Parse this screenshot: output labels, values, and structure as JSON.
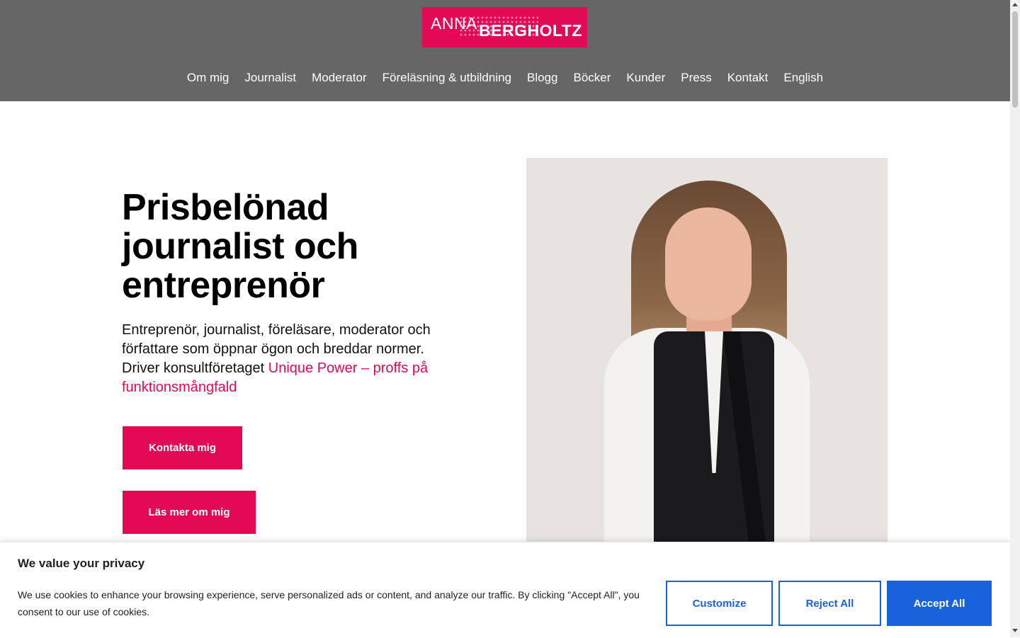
{
  "brand": {
    "first_name": "ANNA",
    "last_name": "BERGHOLTZ",
    "accent_color": "#e20a54",
    "header_color": "#666666"
  },
  "nav": {
    "items": [
      {
        "label": "Om mig"
      },
      {
        "label": "Journalist"
      },
      {
        "label": "Moderator"
      },
      {
        "label": "Föreläsning & utbildning"
      },
      {
        "label": "Blogg"
      },
      {
        "label": "Böcker"
      },
      {
        "label": "Kunder"
      },
      {
        "label": "Press"
      },
      {
        "label": "Kontakt"
      },
      {
        "label": "English"
      }
    ]
  },
  "hero": {
    "title": "Prisbelönad journalist och entreprenör",
    "text": "Entreprenör, journalist, föreläsare, moderator och författare som öppnar ögon och breddar normer. Driver konsultföretaget ",
    "link_text": "Unique Power – proffs på funktionsmångfald",
    "button_contact": "Kontakta mig",
    "button_more": "Läs mer om mig"
  },
  "cookie": {
    "title": "We value your privacy",
    "text": "We use cookies to enhance your browsing experience, serve personalized ads or content, and analyze our traffic. By clicking \"Accept All\", you consent to our use of cookies.",
    "customize": "Customize",
    "reject": "Reject All",
    "accept": "Accept All",
    "button_color": "#1863dc"
  }
}
